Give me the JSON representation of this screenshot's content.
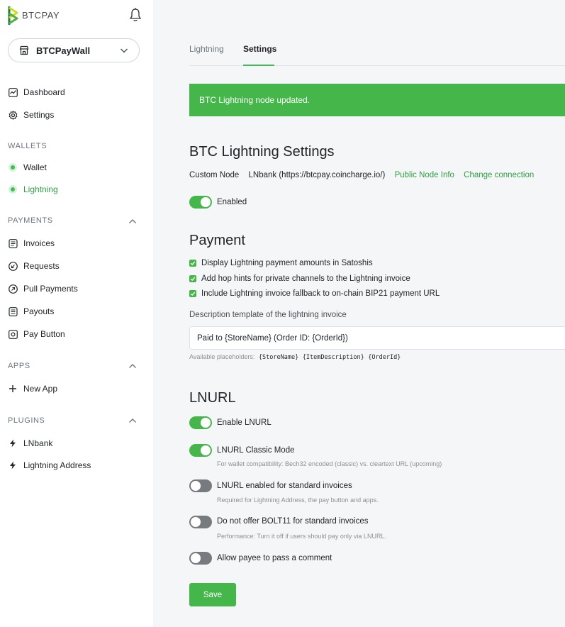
{
  "brand": {
    "logo_text": "BTCPAY"
  },
  "store_selector": {
    "name": "BTCPayWall"
  },
  "nav": {
    "top": [
      {
        "label": "Dashboard",
        "icon": "dashboard-icon"
      },
      {
        "label": "Settings",
        "icon": "gear-icon"
      }
    ],
    "wallets_label": "WALLETS",
    "wallets": [
      {
        "label": "Wallet",
        "active": false
      },
      {
        "label": "Lightning",
        "active": true
      }
    ],
    "payments_label": "PAYMENTS",
    "payments": [
      {
        "label": "Invoices",
        "icon": "invoice-icon"
      },
      {
        "label": "Requests",
        "icon": "request-icon"
      },
      {
        "label": "Pull Payments",
        "icon": "pull-payment-icon"
      },
      {
        "label": "Payouts",
        "icon": "payout-icon"
      },
      {
        "label": "Pay Button",
        "icon": "pay-button-icon"
      }
    ],
    "apps_label": "APPS",
    "apps": [
      {
        "label": "New App",
        "icon": "plus-icon"
      }
    ],
    "plugins_label": "PLUGINS",
    "plugins": [
      {
        "label": "LNbank",
        "icon": "lightning-icon"
      },
      {
        "label": "Lightning Address",
        "icon": "lightning-icon"
      }
    ]
  },
  "tabs": [
    {
      "label": "Lightning",
      "active": false
    },
    {
      "label": "Settings",
      "active": true
    }
  ],
  "alert": {
    "text": "BTC Lightning node updated."
  },
  "lightning_settings": {
    "title": "BTC Lightning Settings",
    "node_type": "Custom Node",
    "node_name": "LNbank (https://btcpay.coincharge.io/)",
    "public_node_info": "Public Node Info",
    "change_connection": "Change connection",
    "enabled_label": "Enabled",
    "enabled": true
  },
  "payment": {
    "title": "Payment",
    "checks": [
      "Display Lightning payment amounts in Satoshis",
      "Add hop hints for private channels to the Lightning invoice",
      "Include Lightning invoice fallback to on-chain BIP21 payment URL"
    ],
    "description_label": "Description template of the lightning invoice",
    "description_value": "Paid to {StoreName} (Order ID: {OrderId})",
    "placeholders_label": "Available placeholders:",
    "placeholders": [
      "{StoreName}",
      "{ItemDescription}",
      "{OrderId}"
    ]
  },
  "lnurl": {
    "title": "LNURL",
    "toggles": [
      {
        "label": "Enable LNURL",
        "on": true,
        "help": ""
      },
      {
        "label": "LNURL Classic Mode",
        "on": true,
        "help": "For wallet compatibility: Bech32 encoded (classic) vs. cleartext URL (upcoming)"
      },
      {
        "label": "LNURL enabled for standard invoices",
        "on": false,
        "help": "Required for Lightning Address, the pay button and apps."
      },
      {
        "label": "Do not offer BOLT11 for standard invoices",
        "on": false,
        "help": "Performance: Turn it off if users should pay only via LNURL."
      },
      {
        "label": "Allow payee to pass a comment",
        "on": false,
        "help": ""
      }
    ],
    "save_label": "Save"
  },
  "colors": {
    "accent": "#45b649",
    "link": "#2e9e44",
    "toggle_off": "#777a7e"
  }
}
